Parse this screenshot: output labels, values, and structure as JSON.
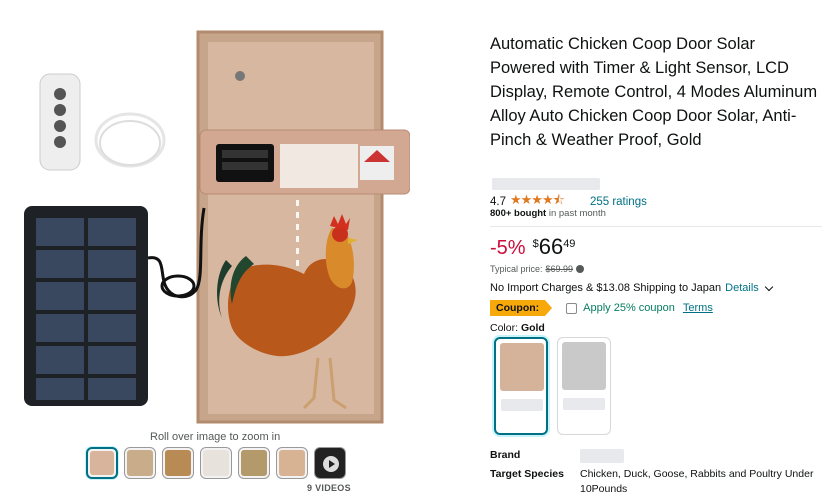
{
  "gallery": {
    "hint": "Roll over image to zoom in",
    "thumbnails": [
      "product-main",
      "product-parts",
      "product-coop",
      "product-display",
      "product-coop-wide",
      "product-door-open"
    ],
    "videos_label": "9 VIDEOS"
  },
  "product": {
    "title": "Automatic Chicken Coop Door Solar Powered with Timer & Light Sensor, LCD Display, Remote Control, 4 Modes Aluminum Alloy Auto Chicken Coop Door Solar, Anti-Pinch & Weather Proof, Gold",
    "rating": "4.7",
    "stars": "★★★★⯪",
    "ratings_count": "255 ratings",
    "bought_bold": "800+ bought",
    "bought_rest": " in past month",
    "discount": "-5%",
    "currency": "$",
    "price_whole": "66",
    "price_fraction": "49",
    "typical_label": "Typical price:",
    "typical_price": "$69.99",
    "import_text": "No Import Charges & $13.08 Shipping to Japan",
    "details_link": "Details",
    "coupon_badge": "Coupon:",
    "coupon_text": "Apply 25% coupon",
    "terms": "Terms",
    "color_label": "Color:",
    "color_value": "Gold",
    "specs": {
      "brand_label": "Brand",
      "target_label": "Target Species",
      "target_value": "Chicken, Duck, Goose, Rabbits and Poultry Under 10Pounds"
    }
  },
  "colors": {
    "link": "#007185",
    "deal_red": "#cc0c39",
    "star": "#de7921",
    "coupon_orange": "#f7a90c",
    "coupon_green": "#067d62"
  }
}
